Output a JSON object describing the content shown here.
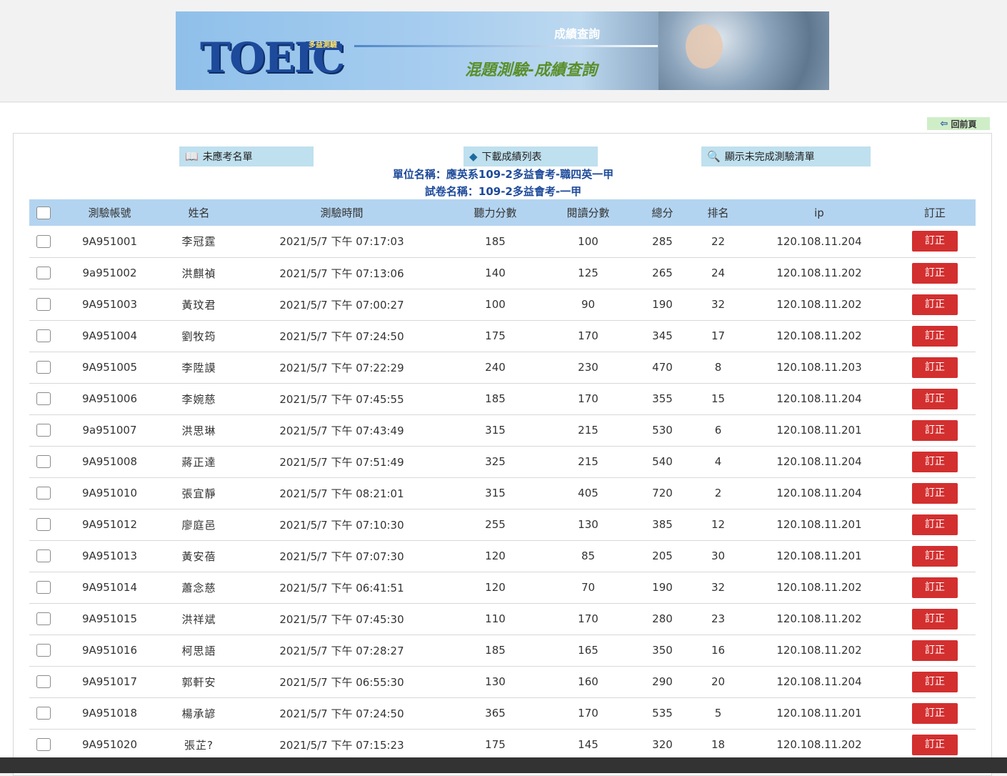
{
  "banner": {
    "logo_text": "TOEIC",
    "logo_sub": "多益測驗",
    "title": "成績查詢",
    "subtitle": "混題測驗-成績查詢"
  },
  "nav": {
    "back_label": "回前頁"
  },
  "toolbar": {
    "absent_label": "未應考名單",
    "download_label": "下載成績列表",
    "incomplete_label": "顯示未完成測驗清單"
  },
  "info": {
    "unit": "單位名稱：應英系109-2多益會考-職四英一甲",
    "paper": "試卷名稱：109-2多益會考-一甲"
  },
  "table": {
    "columns": [
      "測驗帳號",
      "姓名",
      "測驗時間",
      "聽力分數",
      "閱讀分數",
      "總分",
      "排名",
      "ip",
      "訂正"
    ],
    "fix_label": "訂正",
    "rows": [
      [
        "9A951001",
        "李冠霆",
        "2021/5/7 下午 07:17:03",
        "185",
        "100",
        "285",
        "22",
        "120.108.11.204"
      ],
      [
        "9a951002",
        "洪麒禎",
        "2021/5/7 下午 07:13:06",
        "140",
        "125",
        "265",
        "24",
        "120.108.11.202"
      ],
      [
        "9A951003",
        "黃玟君",
        "2021/5/7 下午 07:00:27",
        "100",
        "90",
        "190",
        "32",
        "120.108.11.202"
      ],
      [
        "9A951004",
        "劉牧筠",
        "2021/5/7 下午 07:24:50",
        "175",
        "170",
        "345",
        "17",
        "120.108.11.202"
      ],
      [
        "9A951005",
        "李陞謨",
        "2021/5/7 下午 07:22:29",
        "240",
        "230",
        "470",
        "8",
        "120.108.11.203"
      ],
      [
        "9A951006",
        "李婉慈",
        "2021/5/7 下午 07:45:55",
        "185",
        "170",
        "355",
        "15",
        "120.108.11.204"
      ],
      [
        "9a951007",
        "洪思琳",
        "2021/5/7 下午 07:43:49",
        "315",
        "215",
        "530",
        "6",
        "120.108.11.201"
      ],
      [
        "9A951008",
        "蔣正達",
        "2021/5/7 下午 07:51:49",
        "325",
        "215",
        "540",
        "4",
        "120.108.11.204"
      ],
      [
        "9A951010",
        "張宜靜",
        "2021/5/7 下午 08:21:01",
        "315",
        "405",
        "720",
        "2",
        "120.108.11.204"
      ],
      [
        "9A951012",
        "廖庭邑",
        "2021/5/7 下午 07:10:30",
        "255",
        "130",
        "385",
        "12",
        "120.108.11.201"
      ],
      [
        "9A951013",
        "黃安蓓",
        "2021/5/7 下午 07:07:30",
        "120",
        "85",
        "205",
        "30",
        "120.108.11.201"
      ],
      [
        "9A951014",
        "蕭念慈",
        "2021/5/7 下午 06:41:51",
        "120",
        "70",
        "190",
        "32",
        "120.108.11.202"
      ],
      [
        "9A951015",
        "洪祥斌",
        "2021/5/7 下午 07:45:30",
        "110",
        "170",
        "280",
        "23",
        "120.108.11.202"
      ],
      [
        "9A951016",
        "柯思語",
        "2021/5/7 下午 07:28:27",
        "185",
        "165",
        "350",
        "16",
        "120.108.11.202"
      ],
      [
        "9A951017",
        "郭軒安",
        "2021/5/7 下午 06:55:30",
        "130",
        "160",
        "290",
        "20",
        "120.108.11.204"
      ],
      [
        "9A951018",
        "楊承諺",
        "2021/5/7 下午 07:24:50",
        "365",
        "170",
        "535",
        "5",
        "120.108.11.201"
      ],
      [
        "9A951020",
        "張芷?",
        "2021/5/7 下午 07:15:23",
        "175",
        "145",
        "320",
        "18",
        "120.108.11.202"
      ]
    ]
  }
}
